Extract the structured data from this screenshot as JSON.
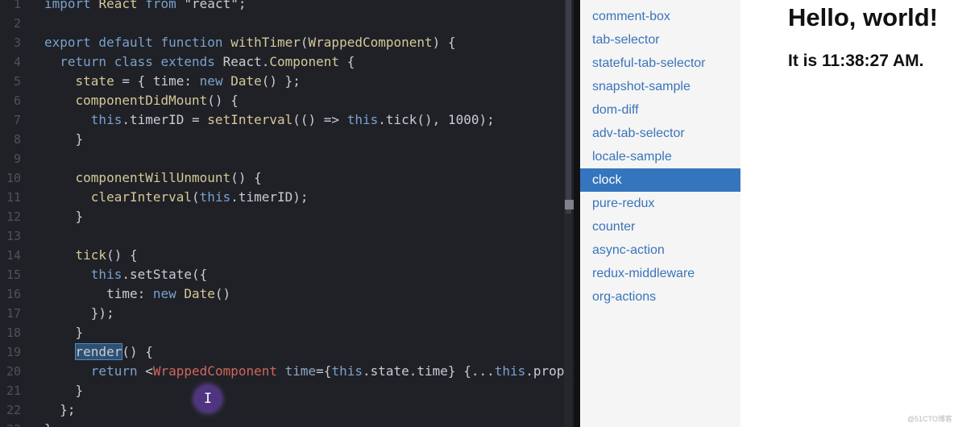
{
  "editor": {
    "lines": [
      {
        "n": "1",
        "parts": [
          [
            "kw",
            "import "
          ],
          [
            "cls",
            "React"
          ],
          [
            "kw",
            " from "
          ],
          [
            "",
            "\"react\";"
          ]
        ]
      },
      {
        "n": "2",
        "parts": []
      },
      {
        "n": "3",
        "parts": [
          [
            "kw",
            "export default function "
          ],
          [
            "fn",
            "withTimer"
          ],
          [
            "",
            "("
          ],
          [
            "cls",
            "WrappedComponent"
          ],
          [
            "",
            ") {"
          ]
        ]
      },
      {
        "n": "4",
        "parts": [
          [
            "",
            "  "
          ],
          [
            "kw",
            "return class extends "
          ],
          [
            "",
            "React."
          ],
          [
            "cls",
            "Component"
          ],
          [
            "",
            " {"
          ]
        ]
      },
      {
        "n": "5",
        "parts": [
          [
            "",
            "    "
          ],
          [
            "fn",
            "state"
          ],
          [
            "",
            " = { "
          ],
          [
            "",
            "time"
          ],
          [
            "",
            ": "
          ],
          [
            "kw",
            "new "
          ],
          [
            "cls",
            "Date"
          ],
          [
            "",
            "() };"
          ]
        ]
      },
      {
        "n": "6",
        "parts": [
          [
            "",
            "    "
          ],
          [
            "fn",
            "componentDidMount"
          ],
          [
            "",
            "() {"
          ]
        ]
      },
      {
        "n": "7",
        "parts": [
          [
            "",
            "      "
          ],
          [
            "kw",
            "this"
          ],
          [
            "",
            ".timerID = "
          ],
          [
            "fn",
            "setInterval"
          ],
          [
            "",
            "(() => "
          ],
          [
            "kw",
            "this"
          ],
          [
            "",
            ".tick(), 1000);"
          ]
        ]
      },
      {
        "n": "8",
        "parts": [
          [
            "",
            "    }"
          ]
        ]
      },
      {
        "n": "9",
        "parts": []
      },
      {
        "n": "10",
        "parts": [
          [
            "",
            "    "
          ],
          [
            "fn",
            "componentWillUnmount"
          ],
          [
            "",
            "() {"
          ]
        ]
      },
      {
        "n": "11",
        "parts": [
          [
            "",
            "      "
          ],
          [
            "fn",
            "clearInterval"
          ],
          [
            "",
            "("
          ],
          [
            "kw",
            "this"
          ],
          [
            "",
            ".timerID);"
          ]
        ]
      },
      {
        "n": "12",
        "parts": [
          [
            "",
            "    }"
          ]
        ]
      },
      {
        "n": "13",
        "parts": []
      },
      {
        "n": "14",
        "parts": [
          [
            "",
            "    "
          ],
          [
            "fn",
            "tick"
          ],
          [
            "",
            "() {"
          ]
        ]
      },
      {
        "n": "15",
        "parts": [
          [
            "",
            "      "
          ],
          [
            "kw",
            "this"
          ],
          [
            "",
            ".setState({"
          ]
        ]
      },
      {
        "n": "16",
        "parts": [
          [
            "",
            "        "
          ],
          [
            "",
            "time: "
          ],
          [
            "kw",
            "new "
          ],
          [
            "cls",
            "Date"
          ],
          [
            "",
            "()"
          ]
        ]
      },
      {
        "n": "17",
        "parts": [
          [
            "",
            "      });"
          ]
        ]
      },
      {
        "n": "18",
        "parts": [
          [
            "",
            "    }"
          ]
        ]
      },
      {
        "n": "19",
        "parts": [
          [
            "",
            "    "
          ],
          [
            "sel",
            "render"
          ],
          [
            "",
            "() {"
          ]
        ]
      },
      {
        "n": "20",
        "parts": [
          [
            "",
            "      "
          ],
          [
            "kw",
            "return "
          ],
          [
            "",
            "<"
          ],
          [
            "tag",
            "WrappedComponent"
          ],
          [
            "attr",
            " time"
          ],
          [
            "",
            "={"
          ],
          [
            "kw",
            "this"
          ],
          [
            "",
            ".state.time} {..."
          ],
          [
            "kw",
            "this"
          ],
          [
            "",
            ".props}"
          ]
        ]
      },
      {
        "n": "21",
        "parts": [
          [
            "",
            "    }"
          ]
        ]
      },
      {
        "n": "22",
        "parts": [
          [
            "",
            "  };"
          ]
        ]
      },
      {
        "n": "23",
        "parts": [
          [
            "",
            "}"
          ]
        ]
      }
    ],
    "cursor_glyph": "I"
  },
  "sidebar": {
    "items": [
      {
        "label": "comment-box",
        "active": false
      },
      {
        "label": "tab-selector",
        "active": false
      },
      {
        "label": "stateful-tab-selector",
        "active": false
      },
      {
        "label": "snapshot-sample",
        "active": false
      },
      {
        "label": "dom-diff",
        "active": false
      },
      {
        "label": "adv-tab-selector",
        "active": false
      },
      {
        "label": "locale-sample",
        "active": false
      },
      {
        "label": "clock",
        "active": true
      },
      {
        "label": "pure-redux",
        "active": false
      },
      {
        "label": "counter",
        "active": false
      },
      {
        "label": "async-action",
        "active": false
      },
      {
        "label": "redux-middleware",
        "active": false
      },
      {
        "label": "org-actions",
        "active": false
      }
    ]
  },
  "main": {
    "title": "Hello, world!",
    "time_text": "It is 11:38:27 AM."
  },
  "watermark": "@51CTO博客",
  "colors": {
    "editor_bg": "#1f2127",
    "keyword": "#7ba0c9",
    "function": "#d6c896",
    "tag": "#d0665c",
    "sidebar_active_bg": "#3575bd",
    "sidebar_link": "#3a74b8"
  }
}
